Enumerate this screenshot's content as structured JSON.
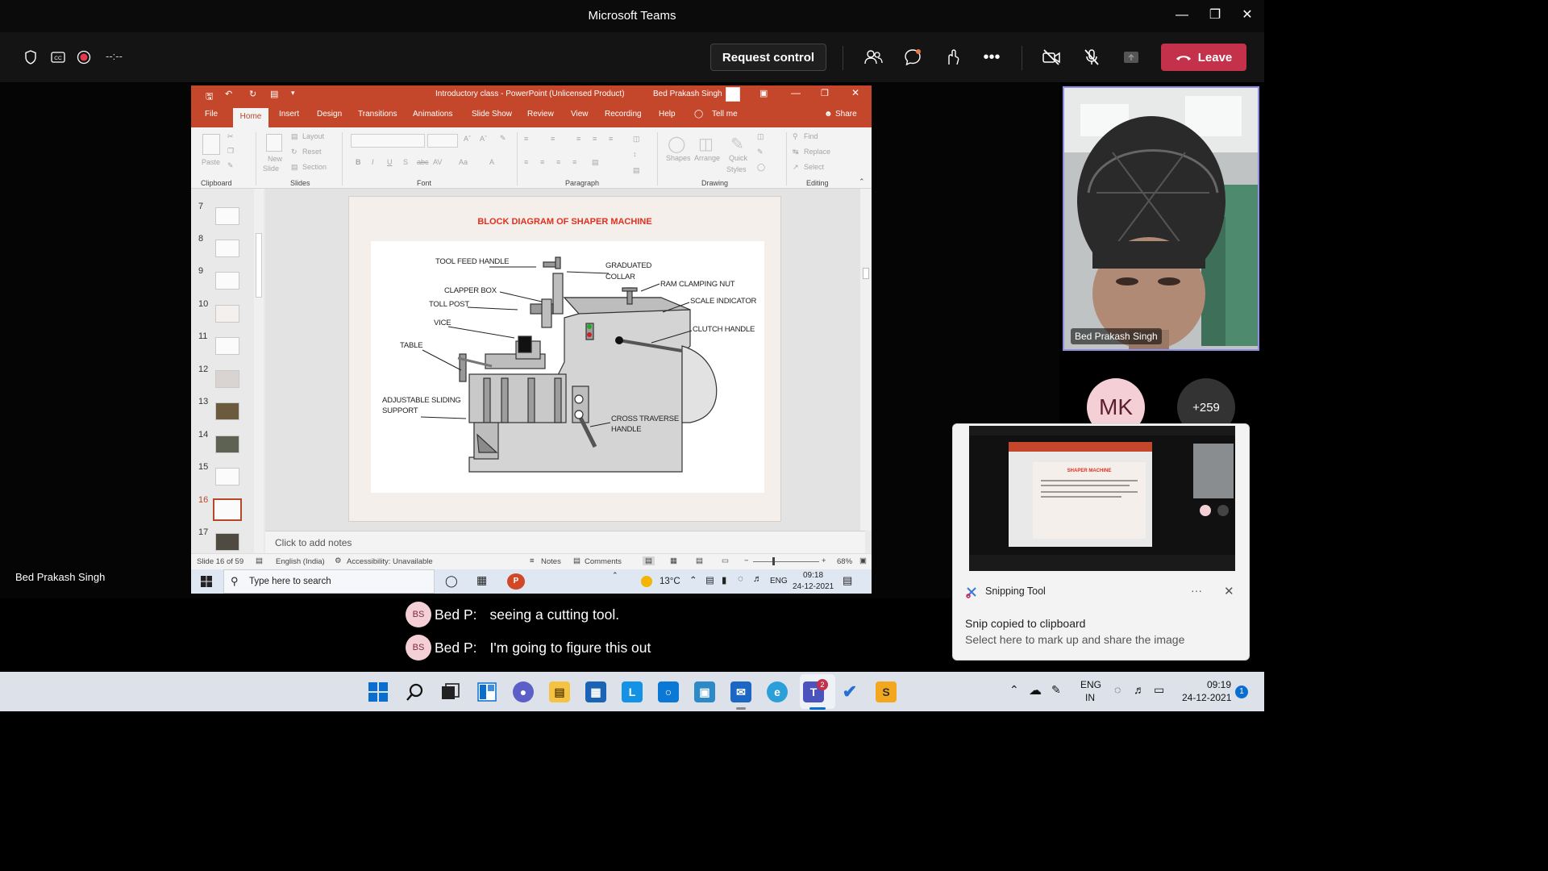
{
  "teams": {
    "window_title": "Microsoft Teams",
    "timer": "--:--",
    "request_control": "Request control",
    "leave": "Leave",
    "presenter_label": "Bed Prakash Singh"
  },
  "ppt": {
    "window_title": "Introductory class  -  PowerPoint (Unlicensed Product)",
    "user": "Bed Prakash Singh",
    "tabs": [
      "File",
      "Home",
      "Insert",
      "Design",
      "Transitions",
      "Animations",
      "Slide Show",
      "Review",
      "View",
      "Recording",
      "Help",
      "Tell me",
      "Share"
    ],
    "ribbon": {
      "paste": "Paste",
      "new_slide": "New",
      "new_slide2": "Slide",
      "layout": "Layout",
      "reset": "Reset",
      "section": "Section",
      "shapes": "Shapes",
      "arrange": "Arrange",
      "quick": "Quick",
      "styles": "Styles",
      "find": "Find",
      "replace": "Replace",
      "select": "Select",
      "groups": [
        "Clipboard",
        "Slides",
        "Font",
        "Paragraph",
        "Drawing",
        "Editing"
      ]
    },
    "thumbnails": [
      "7",
      "8",
      "9",
      "10",
      "11",
      "12",
      "13",
      "14",
      "15",
      "16",
      "17"
    ],
    "slide": {
      "title": "BLOCK DIAGRAM OF SHAPER MACHINE",
      "labels": {
        "tool_feed_handle": "TOOL FEED HANDLE",
        "graduated": "GRADUATED",
        "collar": "COLLAR",
        "clapper_box": "CLAPPER BOX",
        "ram_clamping_nut": "RAM CLAMPING NUT",
        "toll_post": "TOLL POST",
        "scale_indicator": "SCALE INDICATOR",
        "vice": "VICE",
        "clutch_handle": "CLUTCH HANDLE",
        "table": "TABLE",
        "adjustable": "ADJUSTABLE SLIDING",
        "support": "SUPPORT",
        "cross_traverse": "CROSS TRAVERSE",
        "handle": "HANDLE"
      }
    },
    "notes_placeholder": "Click to add notes",
    "status": {
      "slide_of": "Slide 16 of 59",
      "language": "English (India)",
      "accessibility": "Accessibility: Unavailable",
      "notes": "Notes",
      "comments": "Comments",
      "zoom": "68%"
    },
    "inner_taskbar": {
      "search_placeholder": "Type here to search",
      "temperature": "13°C",
      "lang": "ENG",
      "time": "09:18",
      "date": "24-12-2021"
    }
  },
  "participants": {
    "video_name": "Bed Prakash Singh",
    "avatar_initials": "MK",
    "more_count": "+259"
  },
  "toast": {
    "app": "Snipping Tool",
    "title": "Snip copied to clipboard",
    "subtitle": "Select here to mark up and share the image",
    "preview_slide_title": "SHAPER MACHINE"
  },
  "captions": [
    {
      "initials": "BS",
      "speaker": "Bed P:",
      "text": "seeing a cutting tool."
    },
    {
      "initials": "BS",
      "speaker": "Bed P:",
      "text": "I'm going to figure this out"
    }
  ],
  "taskbar": {
    "lang": "ENG",
    "region": "IN",
    "time": "09:19",
    "date": "24-12-2021",
    "teams_badge": "2",
    "notification_count": "1"
  },
  "colors": {
    "ppt_accent": "#c5472b",
    "leave_red": "#c4314b",
    "slide_title_red": "#e0301e",
    "speaker_border": "#8f8fe6"
  }
}
